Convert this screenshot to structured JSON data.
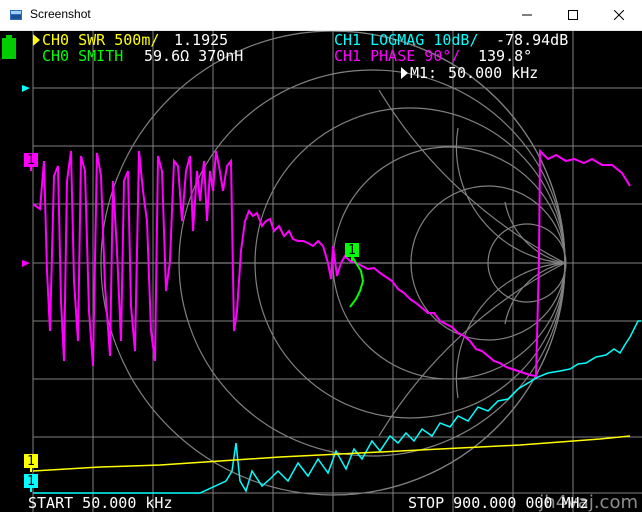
{
  "window": {
    "title": "Screenshot"
  },
  "colors": {
    "yellow": "#ffff00",
    "green": "#00ff00",
    "cyan": "#00ffff",
    "magenta": "#ff00ff",
    "grid": "#808080",
    "battery": "#00cc00"
  },
  "icons": {
    "app": "screenshot-app-icon",
    "minimize": "minimize-icon",
    "maximize": "maximize-icon",
    "close": "close-icon",
    "battery": "battery-icon"
  },
  "traces": {
    "ch0_swr": {
      "label": "CH0 SWR 500m/",
      "value": "1.1925"
    },
    "ch0_smith": {
      "label": "CH0 SMITH",
      "value": "59.6Ω 370nH"
    },
    "ch1_logmag": {
      "label": "CH1 LOGMAG 10dB/",
      "value": "-78.94dB"
    },
    "ch1_phase": {
      "label": "CH1 PHASE 90°/",
      "value": "139.8°"
    }
  },
  "marker": {
    "label": "M1:",
    "value": "50.000 kHz",
    "number": "1"
  },
  "sweep": {
    "start": "START 50.000 kHz",
    "stop": "STOP 900.000 000 MHz"
  },
  "watermark": "jh4vaj.com"
}
